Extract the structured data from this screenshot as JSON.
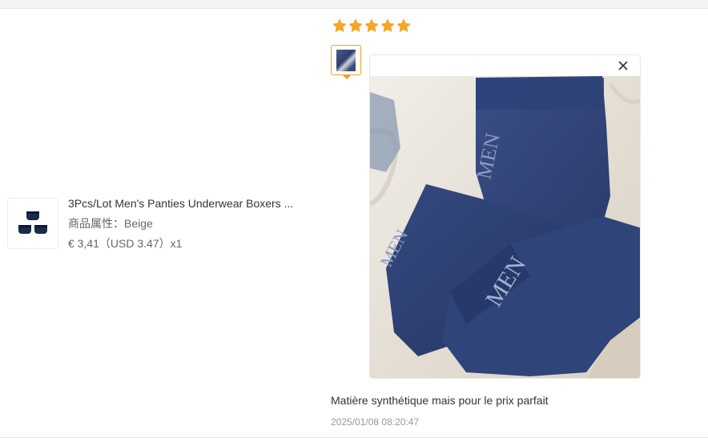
{
  "product": {
    "name": "3Pcs/Lot Men's Panties Underwear Boxers ...",
    "attribute": "商品属性：Beige",
    "price": "€ 3,41（USD  3.47）x1",
    "thumbnail_icon": "boxers-thumbnail"
  },
  "review": {
    "rating": 5,
    "max_rating": 5,
    "star_color": "#f5a623",
    "text": "Matière synthétique mais pour le prix parfait",
    "date": "2025/01/08 08:20:47",
    "thumbnail_icon": "review-photo-thumbnail",
    "photo_print": "MEN",
    "accent_color": "#f0a020"
  },
  "preview": {
    "close_icon": "close-icon"
  }
}
